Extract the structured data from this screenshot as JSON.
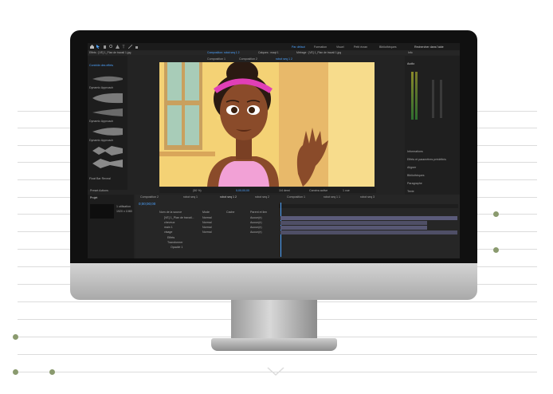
{
  "screen": {
    "menu": {
      "search_label": "Rechercher dans l'aide",
      "workspaces": [
        "Par défaut",
        "Formation",
        "Visuel",
        "Petit écran",
        "Bibliothèques"
      ]
    },
    "tabs": [
      "Effets : [VE] 1_Plan de travail 1.jpg",
      "Composition: robot seq 1 2",
      "Calques : maqt 1",
      "Métrage : [VE] 1_Plan de travail 1.jpg"
    ],
    "subtabs": [
      "Composition 1",
      "Composition 2",
      "robot seq 1 2"
    ],
    "effects_panel": {
      "title": "Contrôle des effets",
      "items": [
        "Dynamic Approach",
        "Dynamic Approach",
        "Dynamic Approach",
        "Float Bar Reveal"
      ]
    },
    "viewer": {
      "zoom": "(50 %)",
      "timecode": "0;00;00;00",
      "quality": "1/4 demi",
      "camera": "Caméra active",
      "views": "1 vue"
    },
    "right_panel": {
      "title": "Audio",
      "sections": [
        "Informations",
        "Effets et paramètres prédéfinis",
        "Aligner",
        "Bibliothèques",
        "Paragraphe",
        "Texte"
      ]
    },
    "project_panel": {
      "title": "Projet",
      "presets": "Preset Actions",
      "items": [
        "1 utilisation",
        "1920 x 1080"
      ]
    },
    "timeline": {
      "tabs": [
        "Composition 2",
        "robot seq 1",
        "robot seq 1 2",
        "robot seq 2",
        "Composition 1",
        "robot seq 1 1",
        "robot seq 3"
      ],
      "timecode": "0;00;00;00",
      "columns": [
        "Nom de la source",
        "Mode",
        "Cache",
        "Parent et lien"
      ],
      "layers": [
        {
          "name": "[VE] 1_Plan de travail...",
          "mode": "Normal",
          "parent": "Aucun(e)"
        },
        {
          "name": "cheveux",
          "mode": "Normal",
          "parent": "Aucun(e)"
        },
        {
          "name": "main 1",
          "mode": "Normal",
          "parent": "Aucun(e)"
        },
        {
          "name": "visage",
          "mode": "Normal",
          "parent": "Aucun(e)"
        }
      ],
      "sub_items": [
        "Effets",
        "Transformer",
        "Opacité 1"
      ]
    }
  },
  "colors": {
    "accent": "#4da3ff",
    "viewer_bg": "#f4d275",
    "headband": "#e03fb6",
    "skin": "#8a4b2a",
    "dots": "#8a9a6e"
  }
}
